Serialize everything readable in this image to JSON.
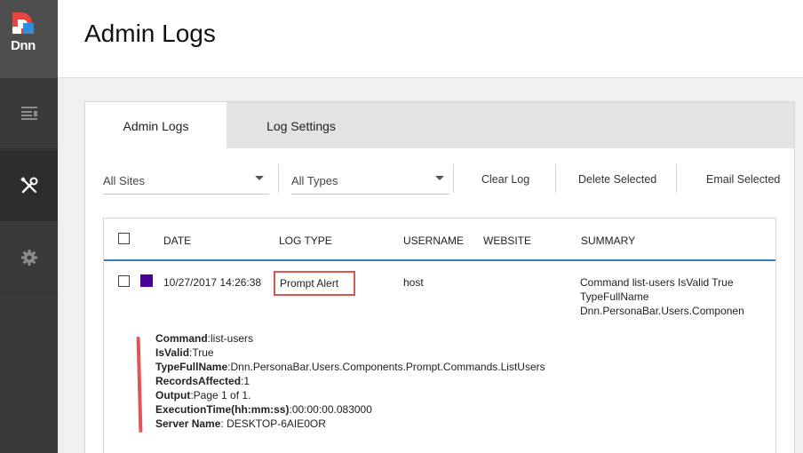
{
  "app": {
    "logo_text": "Dnn"
  },
  "sidebar": {
    "items": [
      {
        "name": "content",
        "icon": "content-icon"
      },
      {
        "name": "tools",
        "icon": "wrench-screwdriver-icon",
        "active": true
      },
      {
        "name": "settings",
        "icon": "gear-icon"
      }
    ]
  },
  "header": {
    "title": "Admin Logs"
  },
  "tabs": [
    {
      "label": "Admin Logs",
      "active": true
    },
    {
      "label": "Log Settings",
      "active": false
    }
  ],
  "toolbar": {
    "sites_dropdown": "All Sites",
    "types_dropdown": "All Types",
    "clear_log": "Clear Log",
    "delete_selected": "Delete Selected",
    "email_selected": "Email Selected"
  },
  "table": {
    "columns": [
      "DATE",
      "LOG TYPE",
      "USERNAME",
      "WEBSITE",
      "SUMMARY"
    ],
    "rows": [
      {
        "color": "#4b0099",
        "date": "10/27/2017 14:26:38",
        "log_type": "Prompt Alert",
        "username": "host",
        "website": "",
        "summary_lines": [
          "Command list-users IsValid True",
          "TypeFullName",
          "Dnn.PersonaBar.Users.Componen"
        ]
      }
    ]
  },
  "details": [
    {
      "key": "Command",
      "sep": ":",
      "value": "list-users"
    },
    {
      "key": "IsValid",
      "sep": ":",
      "value": "True"
    },
    {
      "key": "TypeFullName",
      "sep": ":",
      "value": "Dnn.PersonaBar.Users.Components.Prompt.Commands.ListUsers"
    },
    {
      "key": "RecordsAffected",
      "sep": ":",
      "value": "1"
    },
    {
      "key": "Output",
      "sep": ":",
      "value": "Page 1 of 1."
    },
    {
      "key": "ExecutionTime(hh:mm:ss)",
      "sep": ":",
      "value": "00:00:00.083000"
    },
    {
      "key": "Server Name",
      "sep": ": ",
      "value": "DESKTOP-6AIE0OR"
    }
  ],
  "colors": {
    "accent": "#3e7bbf",
    "highlight": "#d9534f",
    "logo_red": "#e8453c",
    "logo_blue": "#2e8ee0"
  }
}
